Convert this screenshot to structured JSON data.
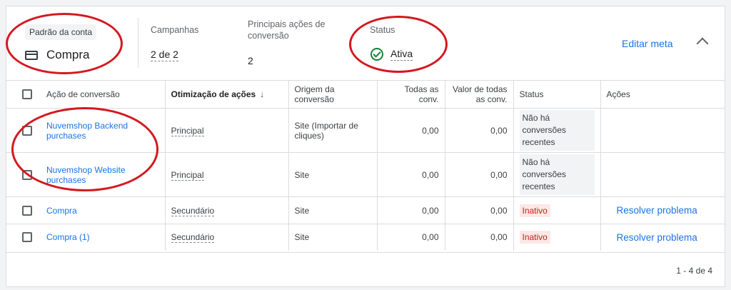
{
  "summary": {
    "account_default_label": "Padrão da conta",
    "account_default_value": "Compra",
    "campaigns_label": "Campanhas",
    "campaigns_value": "2 de 2",
    "primary_actions_label": "Principais ações de conversão",
    "primary_actions_value": "2",
    "status_label": "Status",
    "status_value": "Ativa",
    "edit_goal": "Editar meta"
  },
  "table": {
    "headers": {
      "action": "Ação de conversão",
      "optimization": "Otimização de ações",
      "origin": "Origem da conversão",
      "all_conv": "Todas as conv.",
      "value_all_conv": "Valor de todas as conv.",
      "status": "Status",
      "actions": "Ações"
    },
    "rows": [
      {
        "name": "Nuvemshop Backend purchases",
        "optimization": "Principal",
        "origin": "Site (Importar de cliques)",
        "all_conv": "0,00",
        "value": "0,00",
        "status": "Não há conversões recentes",
        "action": ""
      },
      {
        "name": "Nuvemshop Website purchases",
        "optimization": "Principal",
        "origin": "Site",
        "all_conv": "0,00",
        "value": "0,00",
        "status": "Não há conversões recentes",
        "action": ""
      },
      {
        "name": "Compra",
        "optimization": "Secundário",
        "origin": "Site",
        "all_conv": "0,00",
        "value": "0,00",
        "status": "Inativo",
        "action": "Resolver problema"
      },
      {
        "name": "Compra (1)",
        "optimization": "Secundário",
        "origin": "Site",
        "all_conv": "0,00",
        "value": "0,00",
        "status": "Inativo",
        "action": "Resolver problema"
      }
    ]
  },
  "pagination": "1 - 4 de 4",
  "colors": {
    "accent": "#1a73e8",
    "annotation": "#d4181f",
    "inactive": "#c5221f",
    "active": "#188038"
  }
}
